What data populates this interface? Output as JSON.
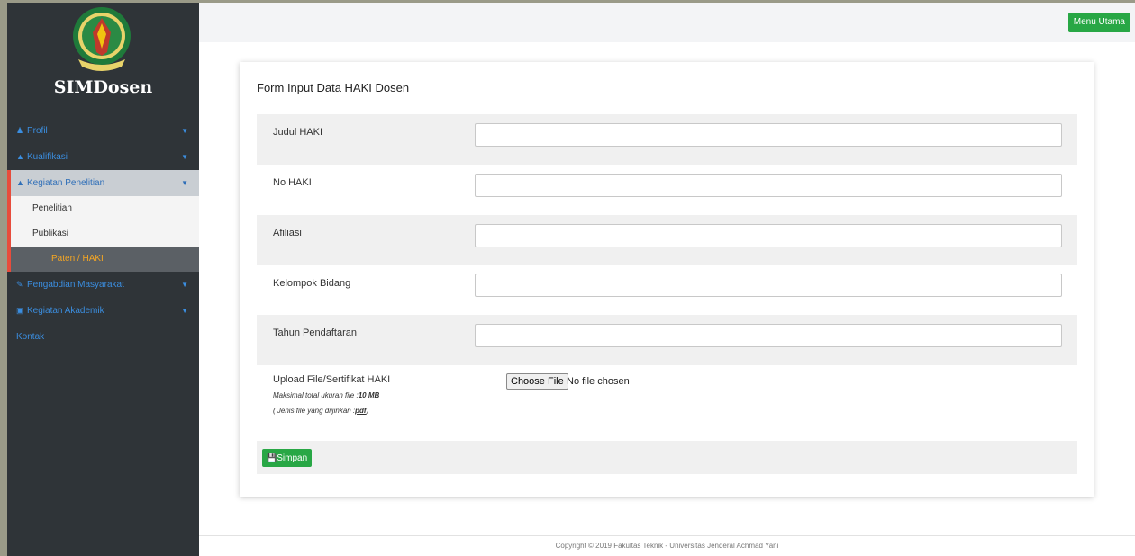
{
  "app": {
    "brand": "SIMDosen"
  },
  "topbar": {
    "menu_button": "Menu Utama"
  },
  "sidebar": {
    "items": [
      {
        "label": "Profil",
        "icon": "user-icon"
      },
      {
        "label": "Kualifikasi",
        "icon": "graduation-cap-icon"
      },
      {
        "label": "Kegiatan Penelitian",
        "icon": "flask-icon"
      },
      {
        "label": "Pengabdian Masyarakat",
        "icon": "handshake-icon"
      },
      {
        "label": "Kegiatan Akademik",
        "icon": "chalkboard-icon"
      },
      {
        "label": "Kontak",
        "icon": ""
      }
    ],
    "sub_items": [
      {
        "label": "Penelitian"
      },
      {
        "label": "Publikasi"
      },
      {
        "label": "Paten / HAKI"
      }
    ]
  },
  "form": {
    "title": "Form Input Data HAKI Dosen",
    "fields": [
      {
        "label": "Judul HAKI",
        "value": ""
      },
      {
        "label": "No HAKI",
        "value": ""
      },
      {
        "label": "Afiliasi",
        "value": ""
      },
      {
        "label": "Kelompok Bidang",
        "value": ""
      },
      {
        "label": "Tahun Pendaftaran",
        "value": ""
      }
    ],
    "upload": {
      "label": "Upload File/Sertifikat HAKI",
      "note1_prefix": "Maksimal total ukuran file :",
      "note1_value": "10 MB",
      "note2_prefix": "( Jenis file yang diijinkan :",
      "note2_value": "pdf",
      "note2_suffix": ")",
      "button": "Choose File",
      "status": "No file chosen"
    },
    "save_button": "Simpan"
  },
  "footer": {
    "copyright": "Copyright © 2019 Fakultas Teknik - Universitas Jenderal Achmad Yani"
  },
  "colors": {
    "sidebar_bg": "#2f3438",
    "accent_green": "#28a745",
    "nav_blue": "#3b8ee0",
    "active_orange": "#f5a623",
    "active_border": "#e74c3c"
  }
}
